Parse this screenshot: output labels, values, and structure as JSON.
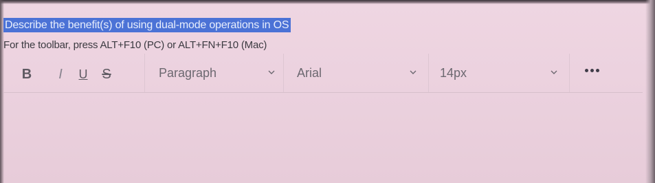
{
  "question": {
    "text": "Describe the benefit(s) of using dual-mode operations in OS"
  },
  "instructions": {
    "text": "For the toolbar, press ALT+F10 (PC) or ALT+FN+F10 (Mac)"
  },
  "toolbar": {
    "bold_label": "B",
    "italic_label": "I",
    "underline_label": "U",
    "strike_label": "S",
    "block_format": "Paragraph",
    "font_family": "Arial",
    "font_size": "14px",
    "more_icon": "more-horizontal-icon",
    "chevron_icon": "chevron-down-icon"
  },
  "editor": {
    "content": ""
  },
  "colors": {
    "selection_highlight": "#4b72d6",
    "background": "#efd6e2"
  }
}
